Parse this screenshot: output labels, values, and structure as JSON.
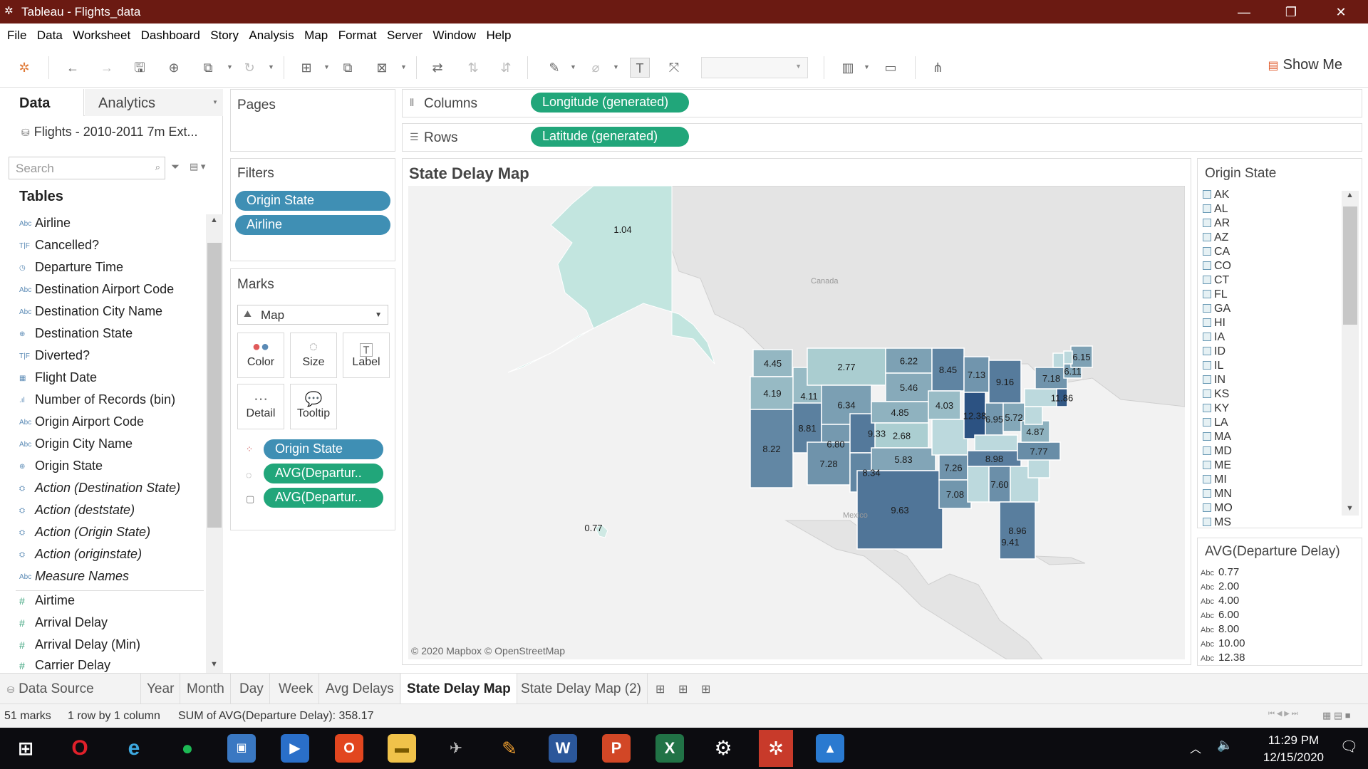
{
  "window": {
    "title": "Tableau - Flights_data"
  },
  "menu": [
    "File",
    "Data",
    "Worksheet",
    "Dashboard",
    "Story",
    "Analysis",
    "Map",
    "Format",
    "Server",
    "Window",
    "Help"
  ],
  "toolbar": {
    "show_me": "Show Me"
  },
  "data_pane": {
    "tab_data": "Data",
    "tab_analytics": "Analytics",
    "source": "Flights - 2010-2011 7m Ext...",
    "search_placeholder": "Search",
    "tables_heading": "Tables",
    "dimensions": [
      {
        "icon": "Abc",
        "name": "Airline"
      },
      {
        "icon": "T|F",
        "name": "Cancelled?"
      },
      {
        "icon": "clock",
        "name": "Departure Time"
      },
      {
        "icon": "Abc",
        "name": "Destination Airport Code"
      },
      {
        "icon": "Abc",
        "name": "Destination City Name"
      },
      {
        "icon": "globe",
        "name": "Destination State"
      },
      {
        "icon": "T|F",
        "name": "Diverted?"
      },
      {
        "icon": "calendar",
        "name": "Flight Date"
      },
      {
        "icon": "bin",
        "name": "Number of Records (bin)"
      },
      {
        "icon": "Abc",
        "name": "Origin Airport Code"
      },
      {
        "icon": "Abc",
        "name": "Origin City Name"
      },
      {
        "icon": "globe",
        "name": "Origin State"
      },
      {
        "icon": "set",
        "name": "Action (Destination State)"
      },
      {
        "icon": "set",
        "name": "Action (deststate)"
      },
      {
        "icon": "set",
        "name": "Action (Origin State)"
      },
      {
        "icon": "set",
        "name": "Action (originstate)"
      },
      {
        "icon": "Abc",
        "name": "Measure Names"
      }
    ],
    "measures": [
      "Airtime",
      "Arrival Delay",
      "Arrival Delay (Min)",
      "Carrier Delay"
    ]
  },
  "pages": {
    "title": "Pages"
  },
  "filters": {
    "title": "Filters",
    "items": [
      "Origin State",
      "Airline"
    ]
  },
  "marks": {
    "title": "Marks",
    "type": "Map",
    "buttons": [
      "Color",
      "Size",
      "Label",
      "Detail",
      "Tooltip"
    ],
    "pills": [
      "Origin State",
      "AVG(Departur..",
      "AVG(Departur.."
    ]
  },
  "shelves": {
    "columns_label": "Columns",
    "columns_pill": "Longitude (generated)",
    "rows_label": "Rows",
    "rows_pill": "Latitude (generated)"
  },
  "viz": {
    "title": "State Delay Map",
    "attribution": "© 2020 Mapbox © OpenStreetMap",
    "map_labels": {
      "canada": "Canada",
      "mexico": "Mexico"
    },
    "state_values": [
      {
        "state": "AK",
        "value": "1.04"
      },
      {
        "state": "WA",
        "value": "4.45"
      },
      {
        "state": "MT",
        "value": "2.77"
      },
      {
        "state": "ND",
        "value": "6.22"
      },
      {
        "state": "MN",
        "value": "8.45"
      },
      {
        "state": "OR",
        "value": "4.19"
      },
      {
        "state": "ID",
        "value": "4.11"
      },
      {
        "state": "SD",
        "value": "5.46"
      },
      {
        "state": "WI",
        "value": "7.13"
      },
      {
        "state": "MI",
        "value": "9.16"
      },
      {
        "state": "ME",
        "value": "6.15"
      },
      {
        "state": "WY",
        "value": "6.34"
      },
      {
        "state": "NE",
        "value": "4.85"
      },
      {
        "state": "IA",
        "value": "4.03"
      },
      {
        "state": "NY",
        "value": "7.18"
      },
      {
        "state": "MA",
        "value": "6.11"
      },
      {
        "state": "NJ",
        "value": "11.86"
      },
      {
        "state": "NV",
        "value": "8.81"
      },
      {
        "state": "UT",
        "value": "6.80"
      },
      {
        "state": "CO",
        "value": "9.33"
      },
      {
        "state": "KS",
        "value": "2.68"
      },
      {
        "state": "IL",
        "value": "12.38"
      },
      {
        "state": "OH",
        "value": "5.72"
      },
      {
        "state": "IN",
        "value": "6.95"
      },
      {
        "state": "VA",
        "value": "4.87"
      },
      {
        "state": "CA",
        "value": "8.22"
      },
      {
        "state": "AZ",
        "value": "7.28"
      },
      {
        "state": "NM",
        "value": "8.34"
      },
      {
        "state": "OK",
        "value": "5.83"
      },
      {
        "state": "AR",
        "value": "7.26"
      },
      {
        "state": "TN",
        "value": "8.98"
      },
      {
        "state": "NC",
        "value": "7.77"
      },
      {
        "state": "TX",
        "value": "9.63"
      },
      {
        "state": "LA",
        "value": "7.08"
      },
      {
        "state": "AL",
        "value": "7.60"
      },
      {
        "state": "FL",
        "value": "8.96"
      },
      {
        "state": "HI",
        "value": "0.77"
      },
      {
        "state": "PR",
        "value": "9.41"
      }
    ]
  },
  "legend_state": {
    "title": "Origin State",
    "items": [
      "AK",
      "AL",
      "AR",
      "AZ",
      "CA",
      "CO",
      "CT",
      "FL",
      "GA",
      "HI",
      "IA",
      "ID",
      "IL",
      "IN",
      "KS",
      "KY",
      "LA",
      "MA",
      "MD",
      "ME",
      "MI",
      "MN",
      "MO",
      "MS"
    ]
  },
  "legend_value": {
    "title": "AVG(Departure Delay)",
    "items": [
      "0.77",
      "2.00",
      "4.00",
      "6.00",
      "8.00",
      "10.00",
      "12.38"
    ],
    "prefix": "Abc"
  },
  "sheet_tabs": {
    "data_source": "Data Source",
    "tabs": [
      "Year",
      "Month",
      "Day",
      "Week",
      "Avg Delays",
      "State Delay Map",
      "State Delay Map (2)"
    ],
    "active": "State Delay Map"
  },
  "status": {
    "marks": "51 marks",
    "dims": "1 row by 1 column",
    "sum": "SUM of AVG(Departure Delay): 358.17"
  },
  "taskbar": {
    "time": "11:29 PM",
    "date": "12/15/2020"
  },
  "colors": {
    "titlebar": "#6b1a12",
    "pill_blue": "#3f8fb4",
    "pill_green": "#21a67a"
  }
}
